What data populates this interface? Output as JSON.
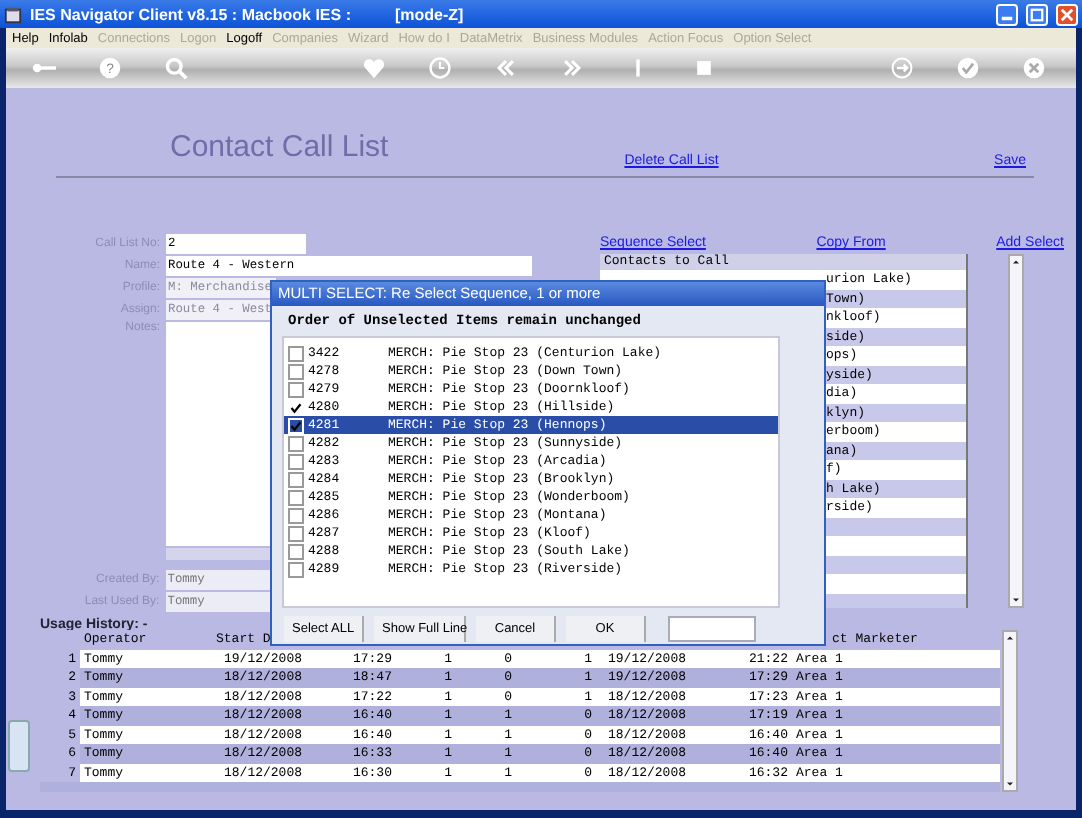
{
  "window": {
    "title": "IES Navigator Client v8.15 : Macbook IES :",
    "mode": "[mode-Z]"
  },
  "menu": [
    {
      "label": "Help",
      "disabled": false
    },
    {
      "label": "Infolab",
      "disabled": false
    },
    {
      "label": "Connections",
      "disabled": true
    },
    {
      "label": "Logon",
      "disabled": true
    },
    {
      "label": "Logoff",
      "disabled": false
    },
    {
      "label": "Companies",
      "disabled": true
    },
    {
      "label": "Wizard",
      "disabled": true
    },
    {
      "label": "How do I",
      "disabled": true
    },
    {
      "label": "DataMetrix",
      "disabled": true
    },
    {
      "label": "Business Modules",
      "disabled": true
    },
    {
      "label": "Action Focus",
      "disabled": true
    },
    {
      "label": "Option Select",
      "disabled": true
    }
  ],
  "page": {
    "title": "Contact Call List",
    "delete_link": "Delete Call List",
    "save_link": "Save"
  },
  "toolbar": {
    "help_glyph": "?"
  },
  "form": {
    "fields": [
      {
        "label": "Call List No:",
        "value": "2",
        "disabled": false
      },
      {
        "label": "Name:",
        "value": "Route 4 - Western",
        "disabled": false
      },
      {
        "label": "Profile:",
        "value": "M: Merchandise",
        "disabled": true
      },
      {
        "label": "Assign:",
        "value": "Route 4 - West",
        "disabled": true
      }
    ],
    "notes_label": "Notes:",
    "created_by": {
      "label": "Created By:",
      "value": "Tommy"
    },
    "last_used_by": {
      "label": "Last Used By:",
      "value": "Tommy"
    }
  },
  "contacts": {
    "links": [
      "Sequence Select",
      "Copy From",
      "Add Select"
    ],
    "header": "Contacts to Call",
    "rows": [
      "urion Lake)",
      "Town)",
      "nkloof)",
      "side)",
      "ops)",
      "yside)",
      "dia)",
      "klyn)",
      "erboom)",
      "ana)",
      "f)",
      "h Lake)",
      "rside)"
    ]
  },
  "dialog": {
    "title": "MULTI SELECT: Re Select Sequence, 1 or more",
    "heading": "Order of Unselected Items remain unchanged",
    "items": [
      {
        "code": "3422",
        "text": "MERCH: Pie Stop 23 (Centurion Lake)",
        "checked": false,
        "selected": false
      },
      {
        "code": "4278",
        "text": "MERCH: Pie Stop 23 (Down Town)",
        "checked": false,
        "selected": false
      },
      {
        "code": "4279",
        "text": "MERCH: Pie Stop 23 (Doornkloof)",
        "checked": false,
        "selected": false
      },
      {
        "code": "4280",
        "text": "MERCH: Pie Stop 23 (Hillside)",
        "checked": true,
        "selected": false
      },
      {
        "code": "4281",
        "text": "MERCH: Pie Stop 23 (Hennops)",
        "checked": true,
        "selected": true
      },
      {
        "code": "4282",
        "text": "MERCH: Pie Stop 23 (Sunnyside)",
        "checked": false,
        "selected": false
      },
      {
        "code": "4283",
        "text": "MERCH: Pie Stop 23 (Arcadia)",
        "checked": false,
        "selected": false
      },
      {
        "code": "4284",
        "text": "MERCH: Pie Stop 23 (Brooklyn)",
        "checked": false,
        "selected": false
      },
      {
        "code": "4285",
        "text": "MERCH: Pie Stop 23 (Wonderboom)",
        "checked": false,
        "selected": false
      },
      {
        "code": "4286",
        "text": "MERCH: Pie Stop 23 (Montana)",
        "checked": false,
        "selected": false
      },
      {
        "code": "4287",
        "text": "MERCH: Pie Stop 23 (Kloof)",
        "checked": false,
        "selected": false
      },
      {
        "code": "4288",
        "text": "MERCH: Pie Stop 23 (South Lake)",
        "checked": false,
        "selected": false
      },
      {
        "code": "4289",
        "text": "MERCH: Pie Stop 23 (Riverside)",
        "checked": false,
        "selected": false
      }
    ],
    "buttons": [
      "Select ALL",
      "Show Full Line",
      "Cancel",
      "OK"
    ]
  },
  "usage": {
    "label": "Usage History: -",
    "header": {
      "operator": "Operator",
      "start_date": "Start D",
      "marketer": "ct Marketer"
    },
    "rows": [
      [
        "1",
        "Tommy",
        "19/12/2008",
        "17:29",
        "1",
        "0",
        "1",
        "19/12/2008",
        "21:22",
        "Area 1"
      ],
      [
        "2",
        "Tommy",
        "18/12/2008",
        "18:47",
        "1",
        "0",
        "1",
        "19/12/2008",
        "17:29",
        "Area 1"
      ],
      [
        "3",
        "Tommy",
        "18/12/2008",
        "17:22",
        "1",
        "0",
        "1",
        "18/12/2008",
        "17:23",
        "Area 1"
      ],
      [
        "4",
        "Tommy",
        "18/12/2008",
        "16:40",
        "1",
        "1",
        "0",
        "18/12/2008",
        "17:19",
        "Area 1"
      ],
      [
        "5",
        "Tommy",
        "18/12/2008",
        "16:40",
        "1",
        "1",
        "0",
        "18/12/2008",
        "16:40",
        "Area 1"
      ],
      [
        "6",
        "Tommy",
        "18/12/2008",
        "16:33",
        "1",
        "1",
        "0",
        "18/12/2008",
        "16:40",
        "Area 1"
      ],
      [
        "7",
        "Tommy",
        "18/12/2008",
        "16:30",
        "1",
        "1",
        "0",
        "18/12/2008",
        "16:32",
        "Area 1"
      ]
    ]
  }
}
